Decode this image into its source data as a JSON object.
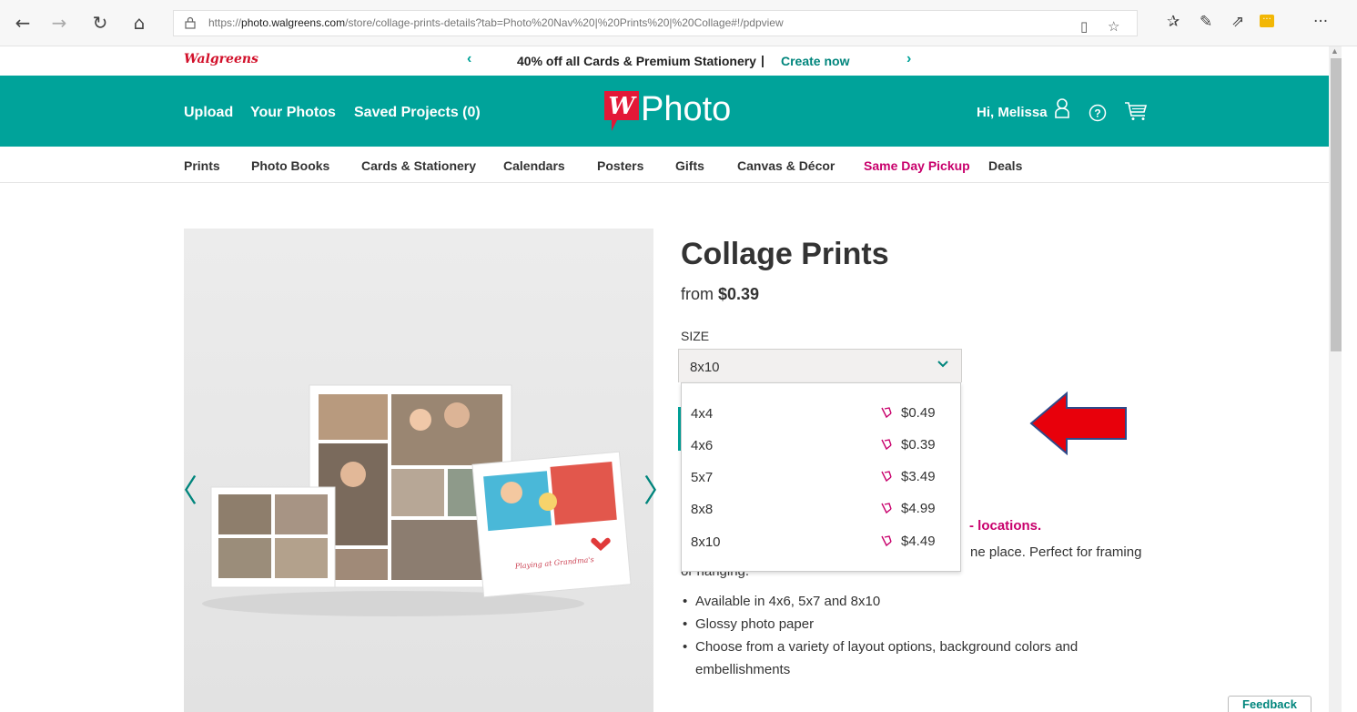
{
  "browser": {
    "url_scheme": "https://",
    "url_host": "photo.walgreens.com",
    "url_path": "/store/collage-prints-details?tab=Photo%20Nav%20|%20Prints%20|%20Collage#!/pdpview"
  },
  "promo": {
    "brand": "Walgreens",
    "prev": "‹",
    "next": "›",
    "text": "40% off all Cards & Premium Stationery",
    "separator": "|",
    "cta": "Create now"
  },
  "header": {
    "links": [
      "Upload",
      "Your Photos",
      "Saved Projects (0)"
    ],
    "logo_letter": "W",
    "logo_text": "Photo",
    "greeting": "Hi, Melissa"
  },
  "nav": {
    "items": [
      "Prints",
      "Photo Books",
      "Cards & Stationery",
      "Calendars",
      "Posters",
      "Gifts",
      "Canvas & Décor",
      "Same Day Pickup",
      "Deals"
    ]
  },
  "product": {
    "title": "Collage Prints",
    "from_label": "from",
    "from_price": "$0.39",
    "size_label": "SIZE",
    "selected_size": "8x10",
    "options": [
      {
        "size": "4x4",
        "price": "$0.49"
      },
      {
        "size": "4x6",
        "price": "$0.39"
      },
      {
        "size": "5x7",
        "price": "$3.49"
      },
      {
        "size": "8x8",
        "price": "$4.99"
      },
      {
        "size": "8x10",
        "price": "$4.49"
      }
    ],
    "stores_text": "- locations.",
    "desc_line1": "ne place. Perfect for framing",
    "desc_line2": "or hanging.",
    "bullets": [
      "Available in 4x6, 5x7 and 8x10",
      "Glossy photo paper",
      "Choose from a variety of layout options, background colors and",
      "embellishments"
    ],
    "image_caption": "Playing at Grandma's"
  },
  "carousel": {
    "prev": "〈",
    "next": "〉"
  },
  "feedback": "Feedback",
  "colors": {
    "teal": "#00a39a",
    "pink": "#c8006c",
    "red": "#d2112b"
  }
}
